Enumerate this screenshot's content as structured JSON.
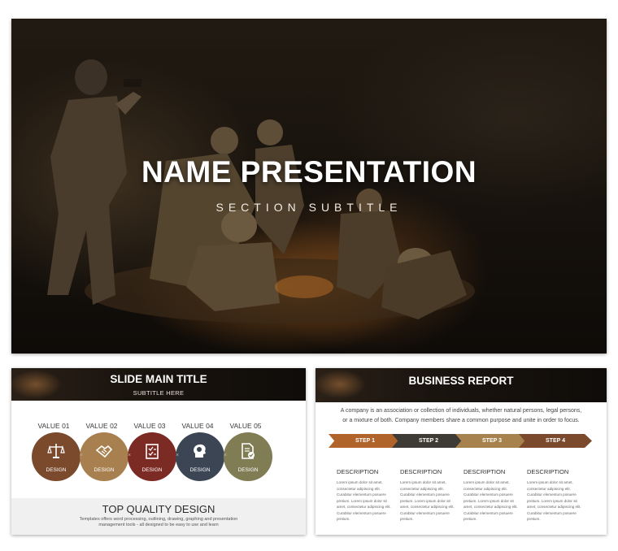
{
  "hero": {
    "title": "NAME PRESENTATION",
    "subtitle": "SECTION SUBTITLE"
  },
  "left_slide": {
    "title": "SLIDE MAIN TITLE",
    "subtitle": "SUBTITLE HERE",
    "values": [
      {
        "label": "VALUE 01",
        "caption": "DESIGN",
        "color": "#7b4a2c",
        "icon": "scales-icon"
      },
      {
        "label": "VALUE 02",
        "caption": "DESIGN",
        "color": "#a88050",
        "icon": "handshake-icon"
      },
      {
        "label": "VALUE 03",
        "caption": "DESIGN",
        "color": "#7c2a24",
        "icon": "checklist-icon"
      },
      {
        "label": "VALUE 04",
        "caption": "DESIGN",
        "color": "#3b4554",
        "icon": "head-gears-icon"
      },
      {
        "label": "VALUE 05",
        "caption": "DESIGN",
        "color": "#807d55",
        "icon": "document-check-icon"
      }
    ],
    "separator": "×",
    "footer_title": "TOP QUALITY DESIGN",
    "footer_text": "Templates offers word processing, outlining, drawing, graphing and presentation management tools - all designed to be easy to use and learn"
  },
  "right_slide": {
    "title": "BUSINESS REPORT",
    "intro": "A company is an association or collection of individuals, whether natural persons, legal persons, or a mixture of both. Company members share a common purpose and unite in order to focus.",
    "steps": [
      {
        "label": "STEP 1",
        "color": "#b0642a"
      },
      {
        "label": "STEP 2",
        "color": "#3e3a35"
      },
      {
        "label": "STEP 3",
        "color": "#a8824c"
      },
      {
        "label": "STEP 4",
        "color": "#7b4a2c"
      }
    ],
    "descriptions": [
      {
        "title": "DESCRIPTION",
        "text": "Lorem ipsum dolor sit amet, consectetur adipiscing elit. Curabitur elementum posuere pretium. Lorem ipsum dolor sit amet, consectetur adipiscing elit. Curabitur elementum posuere pretium."
      },
      {
        "title": "DESCRIPTION",
        "text": "Lorem ipsum dolor sit amet, consectetur adipiscing elit. Curabitur elementum posuere pretium. Lorem ipsum dolor sit amet, consectetur adipiscing elit. Curabitur elementum posuere pretium."
      },
      {
        "title": "DESCRIPTION",
        "text": "Lorem ipsum dolor sit amet, consectetur adipiscing elit. Curabitur elementum posuere pretium. Lorem ipsum dolor sit amet, consectetur adipiscing elit. Curabitur elementum posuere pretium."
      },
      {
        "title": "DESCRIPTION",
        "text": "Lorem ipsum dolor sit amet, consectetur adipiscing elit. Curabitur elementum posuere pretium. Lorem ipsum dolor sit amet, consectetur adipiscing elit. Curabitur elementum posuere pretium."
      }
    ]
  }
}
